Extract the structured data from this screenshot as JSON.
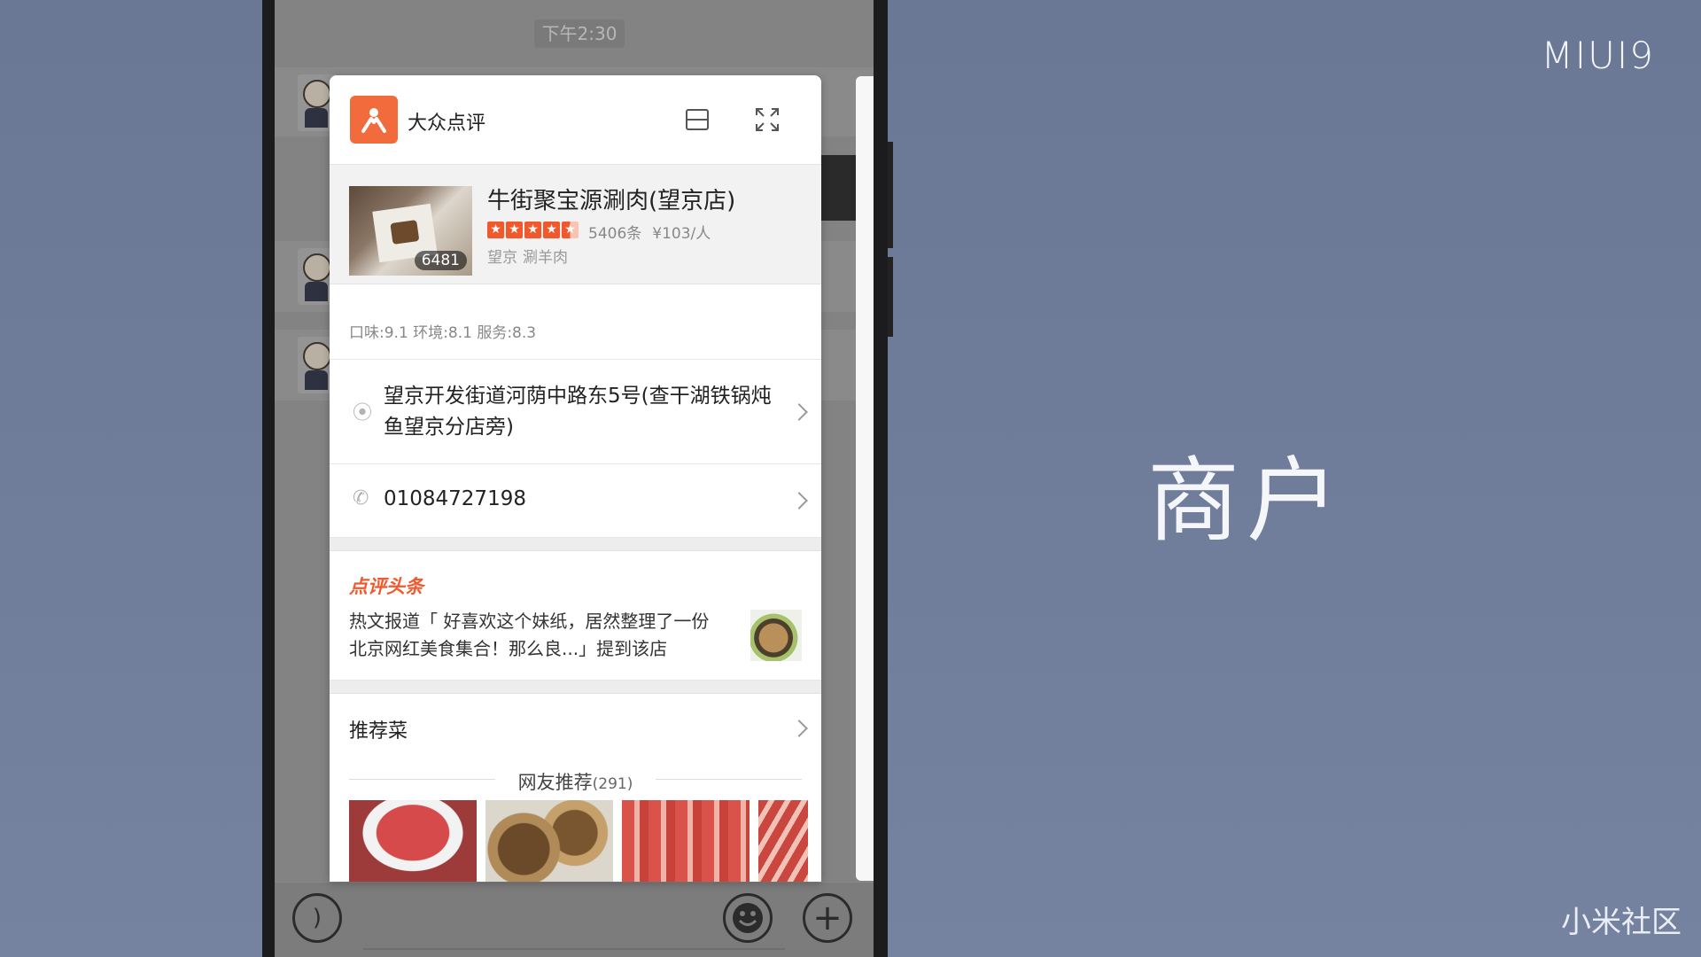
{
  "slide": {
    "brand": "MIUI9",
    "headline": "商户",
    "watermark": "小米社区"
  },
  "chat": {
    "time": "下午2:30"
  },
  "card": {
    "app_name": "大众点评",
    "shop": {
      "name": "牛街聚宝源涮肉(望京店)",
      "photo_count": "6481",
      "rating": 4.5,
      "reviews": "5406条",
      "price": "¥103/人",
      "area": "望京",
      "category": "涮羊肉"
    },
    "scores": "口味:9.1 环境:8.1 服务:8.3",
    "address": "望京开发街道河荫中路东5号(查干湖铁锅炖鱼望京分店旁)",
    "phone": "01084727198",
    "news": {
      "badge": "点评头条",
      "text": "热文报道「 好喜欢这个妹纸，居然整理了一份北京网红美食集合！那么良...」提到该店"
    },
    "recommend": {
      "title": "推荐菜",
      "subtitle": "网友推荐",
      "count": "(291)"
    }
  },
  "colors": {
    "accent": "#f1582c",
    "logo": "#f16b3d",
    "background": "#6f7d9b"
  }
}
